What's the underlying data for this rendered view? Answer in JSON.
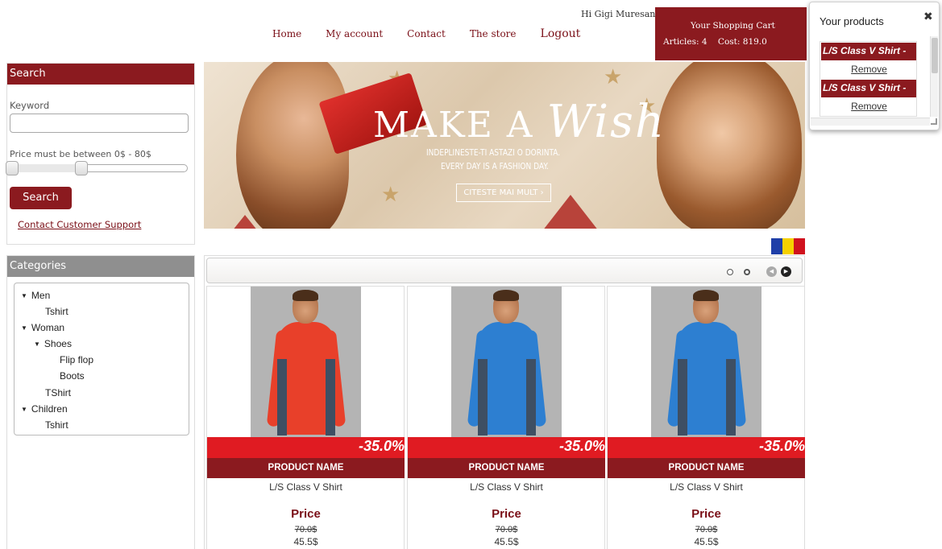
{
  "header": {
    "greeting": "Hi Gigi Muresan",
    "nav": [
      "Home",
      "My account",
      "Contact",
      "The store",
      "Logout"
    ]
  },
  "cart": {
    "title": "Your Shopping Cart",
    "articles": "Articles: 4",
    "cost": "Cost: 819.0",
    "color": "#8b1a1f"
  },
  "popup": {
    "title": "Your products",
    "close": "✖",
    "items": [
      {
        "name": "L/S Class V Shirt -",
        "remove": "Remove"
      },
      {
        "name": "L/S Class V Shirt -",
        "remove": "Remove"
      }
    ]
  },
  "search": {
    "title": "Search",
    "keyword_label": "Keyword",
    "keyword_value": "",
    "price_label": "Price must be between 0$ - 80$",
    "slider_range": [
      0,
      80
    ],
    "button": "Search",
    "support_link": "Contact Customer Support"
  },
  "categories": {
    "title": "Categories",
    "nodes": [
      "Men",
      "Tshirt",
      "Woman",
      "Shoes",
      "Flip flop",
      "Boots",
      "TShirt",
      "Children",
      "Tshirt"
    ]
  },
  "banner": {
    "title_a": "MAKE A",
    "title_b": "Wish",
    "line1": "INDEPLINESTE-TI ASTAZI O DORINTA.",
    "line2": "EVERY DAY IS A FASHION DAY.",
    "cta": "CITESTE MAI MULT ›"
  },
  "flag": {
    "colors": [
      "#1f3fa8",
      "#f5d000",
      "#d0121e"
    ]
  },
  "products": [
    {
      "discount": "-35.0%",
      "header": "PRODUCT NAME",
      "name": "L/S Class V Shirt",
      "price_label": "Price",
      "old_price": "70.0$",
      "new_price": "45.5$",
      "shirt_color": "#e8402a",
      "accent": "#3e4f63"
    },
    {
      "discount": "-35.0%",
      "header": "PRODUCT NAME",
      "name": "L/S Class V Shirt",
      "price_label": "Price",
      "old_price": "70.0$",
      "new_price": "45.5$",
      "shirt_color": "#2d7fd1",
      "accent": "#3e4f63"
    },
    {
      "discount": "-35.0%",
      "header": "PRODUCT NAME",
      "name": "L/S Class V Shirt",
      "price_label": "Price",
      "old_price": "70.0$",
      "new_price": "45.5$",
      "shirt_color": "#2d7fd1",
      "accent": "#3e4f63"
    }
  ]
}
